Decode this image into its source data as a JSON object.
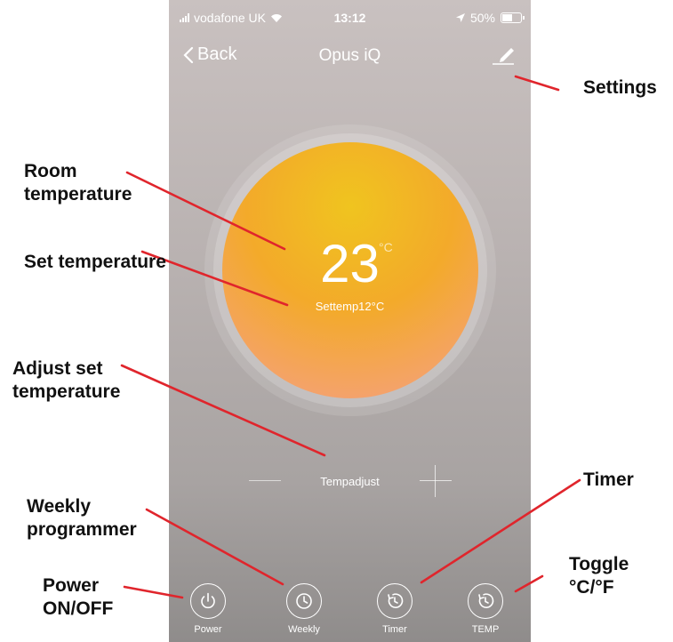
{
  "status_bar": {
    "carrier": "vodafone UK",
    "time": "13:12",
    "battery": "50%"
  },
  "nav": {
    "back_label": "Back",
    "title": "Opus iQ"
  },
  "dial": {
    "room_temp": "23",
    "unit": "°C",
    "set_temp": "Settemp12°C"
  },
  "adjust": {
    "label": "Tempadjust"
  },
  "bottom_bar": {
    "items": [
      {
        "label": "Power",
        "icon": "power-icon"
      },
      {
        "label": "Weekly",
        "icon": "clock-icon"
      },
      {
        "label": "Timer",
        "icon": "timer-icon"
      },
      {
        "label": "TEMP",
        "icon": "toggle-temp-icon"
      }
    ]
  },
  "annotations": {
    "settings": "Settings",
    "room_temperature": "Room temperature",
    "set_temperature": "Set temperature",
    "adjust_set_temperature": "Adjust set temperature",
    "weekly_programmer": "Weekly programmer",
    "power": "Power ON/OFF",
    "timer": "Timer",
    "toggle": "Toggle °C/°F"
  },
  "colors": {
    "annotation_line": "#e0252c",
    "dial_top": "#f0c41f",
    "dial_bottom": "#f0ad85"
  }
}
